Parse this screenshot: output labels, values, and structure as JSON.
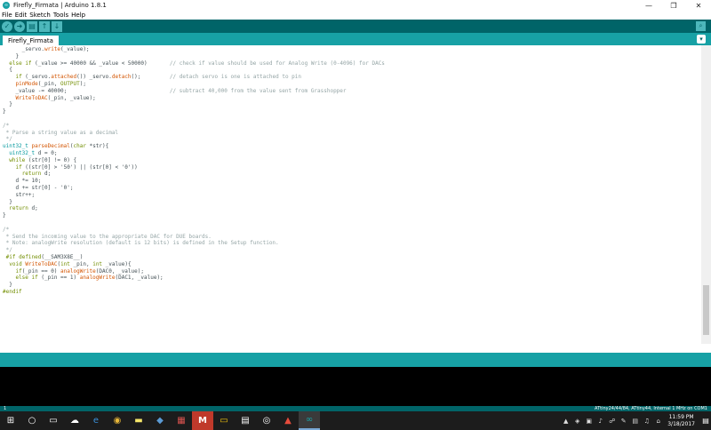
{
  "window": {
    "title": "Firefly_Firmata | Arduino 1.8.1",
    "minimize": "—",
    "restore": "❐",
    "close": "✕"
  },
  "menu": [
    "File",
    "Edit",
    "Sketch",
    "Tools",
    "Help"
  ],
  "toolbar": {
    "verify_icon": "✓",
    "upload_icon": "➜",
    "new_icon": "▤",
    "open_icon": "↑",
    "save_icon": "↓",
    "serial_monitor_icon": "⌕"
  },
  "tab": {
    "label": "Firefly_Firmata",
    "menu_icon": "▾"
  },
  "code_lines": [
    "      _servo.write(_value);",
    "    }",
    "  else if (_value >= 40000 && _value < 50000)       // check if value should be used for Analog Write (0-4096) for DACs",
    "  {",
    "    if (_servo.attached()) _servo.detach();         // detach servo is one is attached to pin",
    "    pinMode(_pin, OUTPUT);",
    "    _value -= 40000;                                // subtract 40,000 from the value sent from Grasshopper",
    "    WriteToDAC(_pin, _value);",
    "  }",
    "}",
    "",
    "/*",
    " * Parse a string value as a decimal",
    " */",
    "uint32_t parseDecimal(char *str){",
    "  uint32_t d = 0;",
    "  while (str[0] != 0) {",
    "    if ((str[0] > '50') || (str[0] < '0'))",
    "      return d;",
    "    d *= 10;",
    "    d += str[0] - '0';",
    "    str++;",
    "  }",
    "  return d;",
    "}",
    "",
    "/*",
    " * Send the incoming value to the appropriate DAC for DUE boards.",
    " * Note: analogWrite resolution (default is 12 bits) is defined in the Setup function.",
    " */",
    " #if defined(__SAM3X8E__)",
    "  void WriteToDAC(int _pin, int _value){",
    "    if(_pin == 0) analogWrite(DAC0, _value);",
    "    else if (_pin == 1) analogWrite(DAC1, _value);",
    "  }",
    "#endif"
  ],
  "status": {
    "line_number": "1",
    "board_info": "ATtiny24/44/84, ATtiny44, Internal 1 MHz on COM1"
  },
  "taskbar": {
    "start_icon": "⊞",
    "search_icon": "○",
    "task_view_icon": "▭",
    "apps": [
      "☁",
      "e",
      "◉",
      "▬",
      "◆",
      "▦",
      "M",
      "▭",
      "▤",
      "◎",
      "▲",
      "∞"
    ],
    "tray": [
      "▲",
      "◈",
      "▣",
      "♪",
      "☍",
      "✎",
      "▤",
      "♫",
      "⌂"
    ],
    "time": "11:59 PM",
    "date": "3/18/2017",
    "notify_icon": "▤"
  },
  "colors": {
    "teal_dark": "#006468",
    "teal": "#17a1a5",
    "keyword": "#728e00",
    "function": "#d35400",
    "type": "#00979c",
    "comment": "#95a5a6"
  }
}
